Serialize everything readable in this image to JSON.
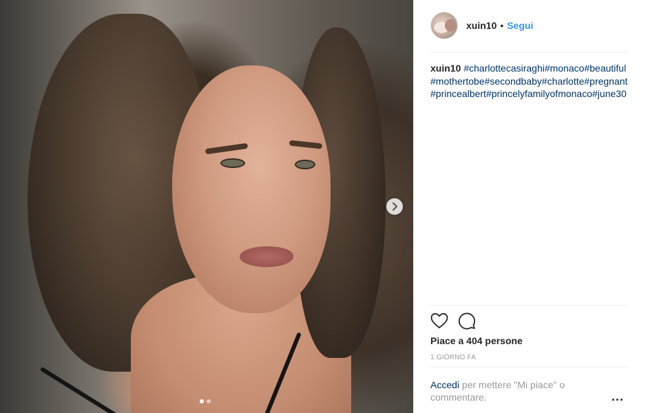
{
  "post": {
    "username": "xuin10",
    "separator": "•",
    "follow_label": "Segui",
    "caption_user": "xuin10",
    "caption_tags": "#charlottecasiraghi#monaco#beautiful#mothertobe#secondbaby#charlotte#pregnant#princealbert#princelyfamilyofmonaco#june30",
    "likes_text": "Piace a 404 persone",
    "time_text": "1 GIORNO FA",
    "login_link": "Accedi",
    "login_text": " per mettere \"Mi piace\" o commentare.",
    "more_label": "..."
  },
  "carousel": {
    "slide_count": 2,
    "active_slide": 1
  },
  "colors": {
    "link_blue": "#3897f0",
    "tag_navy": "#003569",
    "text_dark": "#262626",
    "text_muted": "#999999",
    "divider": "#efefef"
  },
  "icons": {
    "like": "heart-outline-icon",
    "comment": "speech-bubble-icon",
    "next": "chevron-right-icon"
  }
}
